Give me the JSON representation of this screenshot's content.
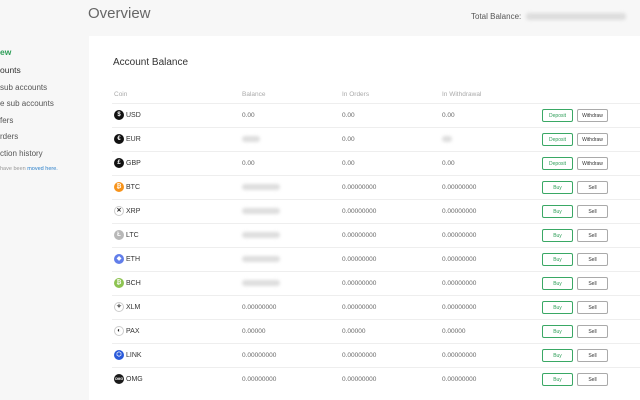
{
  "sidebar": {
    "items": [
      {
        "label": "ew",
        "state": "active"
      },
      {
        "label": "ounts",
        "state": "main"
      },
      {
        "label": "sub accounts",
        "state": "sub"
      },
      {
        "label": "e sub accounts",
        "state": "sub"
      },
      {
        "label": "fers",
        "state": "sub"
      },
      {
        "label": "rders",
        "state": "sub"
      },
      {
        "label": "ction history",
        "state": "sub"
      }
    ],
    "note_prefix": "have been ",
    "note_link": "moved here."
  },
  "header": {
    "title": "Overview",
    "total_label": "Total Balance:"
  },
  "card": {
    "title": "Account Balance",
    "columns": [
      "Coin",
      "Balance",
      "In Orders",
      "In Withdrawal"
    ]
  },
  "rows": [
    {
      "coin": "USD",
      "icon": "dollar-icon",
      "icon_char": "$",
      "icon_color": "#111111",
      "balance": "0.00",
      "in_orders": "0.00",
      "in_withdrawal": "0.00",
      "balance_blurred": false,
      "withdrawal_blurred": false,
      "actions": [
        "Deposit",
        "Withdraw"
      ]
    },
    {
      "coin": "EUR",
      "icon": "euro-icon",
      "icon_char": "€",
      "icon_color": "#111111",
      "balance": "",
      "in_orders": "0.00",
      "in_withdrawal": "",
      "balance_blurred": true,
      "withdrawal_blurred": true,
      "actions": [
        "Deposit",
        "Withdraw"
      ]
    },
    {
      "coin": "GBP",
      "icon": "pound-icon",
      "icon_char": "£",
      "icon_color": "#111111",
      "balance": "0.00",
      "in_orders": "0.00",
      "in_withdrawal": "0.00",
      "balance_blurred": false,
      "withdrawal_blurred": false,
      "actions": [
        "Deposit",
        "Withdraw"
      ]
    },
    {
      "coin": "BTC",
      "icon": "bitcoin-icon",
      "icon_char": "₿",
      "icon_color": "#f7931a",
      "balance": "",
      "in_orders": "0.00000000",
      "in_withdrawal": "0.00000000",
      "balance_blurred": true,
      "withdrawal_blurred": false,
      "actions": [
        "Buy",
        "Sell"
      ]
    },
    {
      "coin": "XRP",
      "icon": "xrp-icon",
      "icon_char": "✕",
      "icon_color": "#ffffff",
      "balance": "",
      "in_orders": "0.00000000",
      "in_withdrawal": "0.00000000",
      "balance_blurred": true,
      "withdrawal_blurred": false,
      "actions": [
        "Buy",
        "Sell"
      ]
    },
    {
      "coin": "LTC",
      "icon": "litecoin-icon",
      "icon_char": "Ł",
      "icon_color": "#b8b8b8",
      "balance": "",
      "in_orders": "0.00000000",
      "in_withdrawal": "0.00000000",
      "balance_blurred": true,
      "withdrawal_blurred": false,
      "actions": [
        "Buy",
        "Sell"
      ]
    },
    {
      "coin": "ETH",
      "icon": "ethereum-icon",
      "icon_char": "◆",
      "icon_color": "#627eea",
      "balance": "",
      "in_orders": "0.00000000",
      "in_withdrawal": "0.00000000",
      "balance_blurred": true,
      "withdrawal_blurred": false,
      "actions": [
        "Buy",
        "Sell"
      ]
    },
    {
      "coin": "BCH",
      "icon": "bitcoin-cash-icon",
      "icon_char": "₿",
      "icon_color": "#8dc351",
      "balance": "",
      "in_orders": "0.00000000",
      "in_withdrawal": "0.00000000",
      "balance_blurred": true,
      "withdrawal_blurred": false,
      "actions": [
        "Buy",
        "Sell"
      ]
    },
    {
      "coin": "XLM",
      "icon": "stellar-icon",
      "icon_char": "✧",
      "icon_color": "#ffffff",
      "balance": "0.00000000",
      "in_orders": "0.00000000",
      "in_withdrawal": "0.00000000",
      "balance_blurred": false,
      "withdrawal_blurred": false,
      "actions": [
        "Buy",
        "Sell"
      ]
    },
    {
      "coin": "PAX",
      "icon": "pax-icon",
      "icon_char": "◐",
      "icon_color": "#ffffff",
      "balance": "0.00000",
      "in_orders": "0.00000",
      "in_withdrawal": "0.00000",
      "balance_blurred": false,
      "withdrawal_blurred": false,
      "actions": [
        "Buy",
        "Sell"
      ]
    },
    {
      "coin": "LINK",
      "icon": "chainlink-icon",
      "icon_char": "⬡",
      "icon_color": "#2a5ada",
      "balance": "0.00000000",
      "in_orders": "0.00000000",
      "in_withdrawal": "0.00000000",
      "balance_blurred": false,
      "withdrawal_blurred": false,
      "actions": [
        "Buy",
        "Sell"
      ]
    },
    {
      "coin": "OMG",
      "icon": "omg-icon",
      "icon_char": "OMG",
      "icon_color": "#1a1a1a",
      "balance": "0.00000000",
      "in_orders": "0.00000000",
      "in_withdrawal": "0.00000000",
      "balance_blurred": false,
      "withdrawal_blurred": false,
      "actions": [
        "Buy",
        "Sell"
      ]
    }
  ],
  "colors": {
    "accent": "#2e9e58",
    "link": "#2a7fc9"
  }
}
